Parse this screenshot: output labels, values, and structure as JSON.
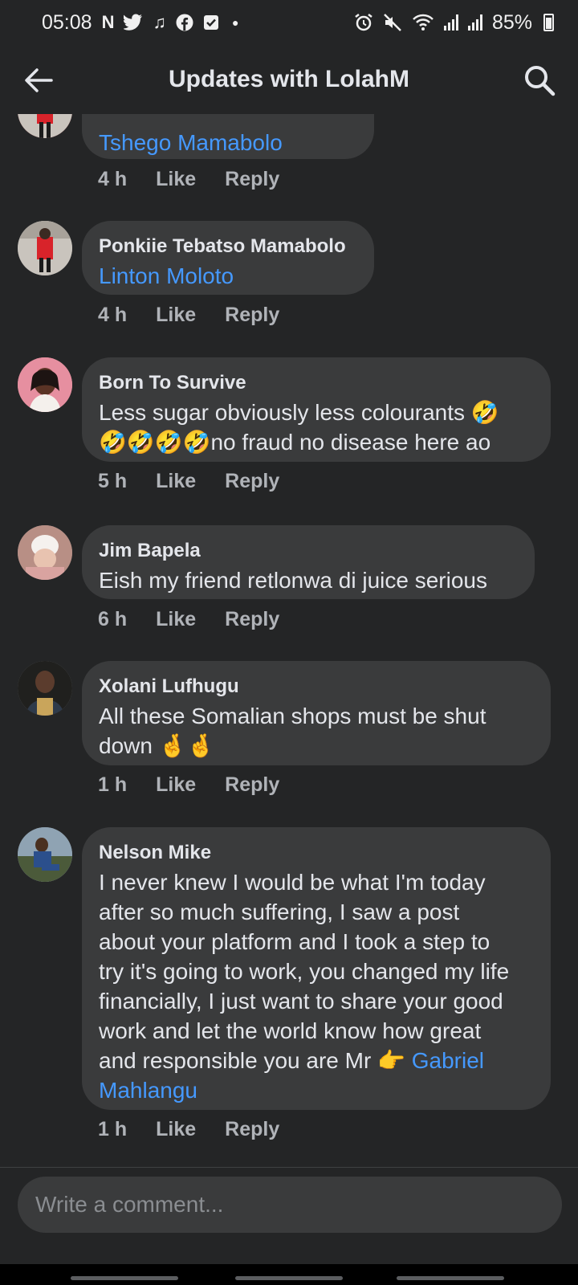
{
  "status_bar": {
    "time": "05:08",
    "battery": "85%",
    "left_icons": [
      "n-icon",
      "twitter-icon",
      "notification-icon",
      "facebook-icon",
      "checkbox-icon",
      "dot"
    ],
    "right_icons": [
      "alarm-icon",
      "mute-icon",
      "wifi-icon",
      "signal-icon",
      "signal-icon",
      "battery-icon"
    ]
  },
  "header": {
    "title": "Updates with LolahM"
  },
  "comments": [
    {
      "author": "",
      "text": "",
      "mention": "Tshego Mamabolo",
      "time": "4 h",
      "like": "Like",
      "reply": "Reply"
    },
    {
      "author": "Ponkiie Tebatso Mamabolo",
      "text": "",
      "mention": "Linton Moloto",
      "time": "4 h",
      "like": "Like",
      "reply": "Reply"
    },
    {
      "author": "Born To Survive",
      "text_line1": "Less sugar obviously less colourants 🤣",
      "text_line2": "🤣🤣🤣🤣no fraud no disease here ao",
      "time": "5 h",
      "like": "Like",
      "reply": "Reply"
    },
    {
      "author": "Jim Bapela",
      "text": "Eish my friend retlonwa di juice serious",
      "time": "6 h",
      "like": "Like",
      "reply": "Reply"
    },
    {
      "author": "Xolani Lufhugu",
      "text_line1": "All these Somalian shops must be shut",
      "text_line2": "down 🤞🤞",
      "time": "1 h",
      "like": "Like",
      "reply": "Reply"
    },
    {
      "author": "Nelson Mike",
      "text_lines": [
        "I never knew I would be what I'm today",
        "after so much suffering, I saw a post",
        "about your platform and I took a step to",
        "try it's going to work, you changed my life",
        "financially, I just want to share your good",
        "work and let the world know how great",
        "and responsible you are Mr  👉 "
      ],
      "mention_line1": "Gabriel",
      "mention_line2": "Mahlangu",
      "time": "1 h",
      "like": "Like",
      "reply": "Reply"
    }
  ],
  "composer": {
    "placeholder": "Write a comment..."
  },
  "colors": {
    "background": "#242526",
    "bubble": "#3a3b3c",
    "mention": "#4599ff",
    "meta": "#b0b3b8"
  }
}
